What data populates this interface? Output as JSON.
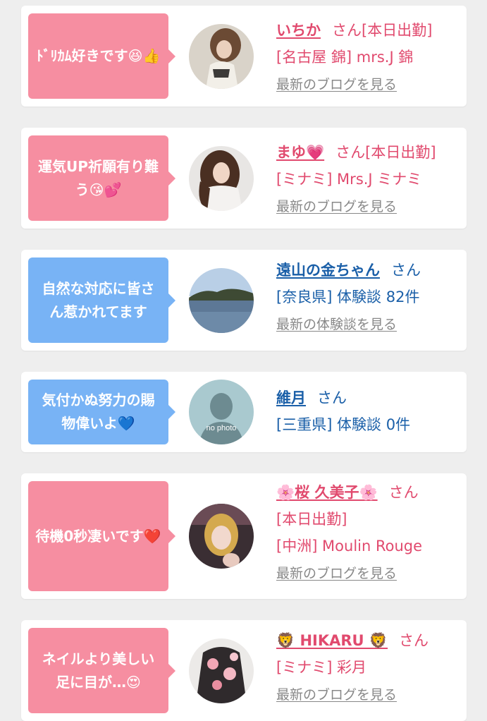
{
  "cards": [
    {
      "bubble": "ﾄﾞﾘｶﾑ好きです😆👍",
      "name": "いちか",
      "honorific": "さん",
      "status": "[本日出勤]",
      "detail": "[名古屋 錦] mrs.J 錦",
      "link": "最新のブログを見る"
    },
    {
      "bubble": "運気UP祈願有り難う😘💕",
      "name": "まゆ💗",
      "honorific": "さん",
      "status": "[本日出勤]",
      "detail": "[ミナミ] Mrs.J ミナミ",
      "link": "最新のブログを見る"
    },
    {
      "bubble": "自然な対応に皆さん惹かれてます",
      "name": "遠山の金ちゃん",
      "honorific": "さん",
      "detail": "[奈良県] 体験談 82件",
      "link": "最新の体験談を見る"
    },
    {
      "bubble": "気付かぬ努力の賜物偉いよ💙",
      "name": "維月",
      "honorific": "さん",
      "detail": "[三重県] 体験談 0件",
      "avatar_text": "no photo"
    },
    {
      "bubble": "待機0秒凄いです❤️",
      "name": "🌸桜 久美子🌸",
      "honorific": "さん",
      "status": "[本日出勤]",
      "detail": "[中洲] Moulin Rouge",
      "link": "最新のブログを見る"
    },
    {
      "bubble": "ネイルより美しい足に目が…😍",
      "name": "🦁 HIKARU 🦁",
      "honorific": "さん",
      "detail": "[ミナミ] 彩月",
      "link": "最新のブログを見る"
    }
  ],
  "colors": {
    "pink_bubble": "#f68ea1",
    "blue_bubble": "#78b3f5",
    "pink_text": "#e14a6e",
    "blue_text": "#1a5fa8"
  }
}
